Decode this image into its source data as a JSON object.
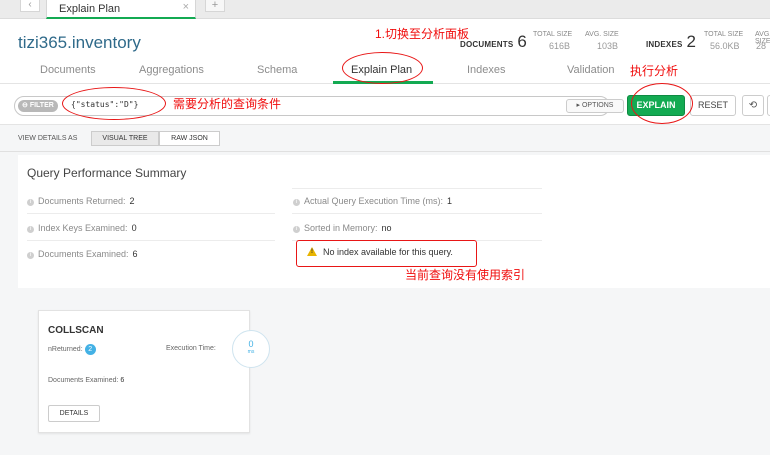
{
  "browser_tab": {
    "back_arrow": "‹",
    "title": "Explain Plan",
    "close": "×",
    "add": "+"
  },
  "header": {
    "namespace": "tizi365.inventory",
    "documents_label": "DOCUMENTS",
    "documents_count": "6",
    "total_size_label": "TOTAL SIZE",
    "total_size_value": "616B",
    "avg_size_label": "AVG. SIZE",
    "avg_size_value": "103B",
    "indexes_label": "INDEXES",
    "indexes_count": "2",
    "idx_total_size_label": "TOTAL SIZE",
    "idx_total_size_value": "56.0KB",
    "idx_avg_size_label": "AVG. SIZE",
    "idx_avg_size_value": "28"
  },
  "subtabs": {
    "documents": "Documents",
    "aggregations": "Aggregations",
    "schema": "Schema",
    "explain_plan": "Explain Plan",
    "indexes": "Indexes",
    "validation": "Validation"
  },
  "querybar": {
    "filter_label": "FILTER",
    "filter_icon": "⊖",
    "filter_value": "{\"status\":\"D\"}",
    "options_label": "▸ OPTIONS",
    "explain_label": "EXPLAIN",
    "reset_label": "RESET",
    "history_icon": "⟲"
  },
  "view_details": {
    "label": "VIEW DETAILS AS",
    "visual_tree": "VISUAL TREE",
    "raw_json": "RAW JSON"
  },
  "summary": {
    "title": "Query Performance Summary",
    "info_glyph": "i",
    "documents_returned_label": "Documents Returned:",
    "documents_returned_value": "2",
    "index_keys_label": "Index Keys Examined:",
    "index_keys_value": "0",
    "documents_examined_label": "Documents Examined:",
    "documents_examined_value": "6",
    "exec_time_label": "Actual Query Execution Time (ms):",
    "exec_time_value": "1",
    "sorted_label": "Sorted in Memory:",
    "sorted_value": "no",
    "warning_mark": "!",
    "warning_text": "No index available for this query."
  },
  "stage": {
    "name": "COLLSCAN",
    "nreturned_label": "nReturned:",
    "nreturned_value": "2",
    "exec_time_label": "Execution Time:",
    "exec_time_value": "0",
    "exec_time_unit": "ms",
    "docs_examined_label": "Documents Examined:",
    "docs_examined_value": "6",
    "details_label": "DETAILS"
  },
  "annotations": {
    "switch_panel": "1.切换至分析面板",
    "run_analysis": "执行分析",
    "query_condition": "需要分析的查询条件",
    "no_index": "当前查询没有使用索引"
  },
  "colors": {
    "accent_green": "#13aa52",
    "annotation_red": "#f00c0c",
    "namespace_blue": "#2f6a8a",
    "badge_blue": "#43b1e5",
    "warning_yellow": "#e8b400"
  }
}
